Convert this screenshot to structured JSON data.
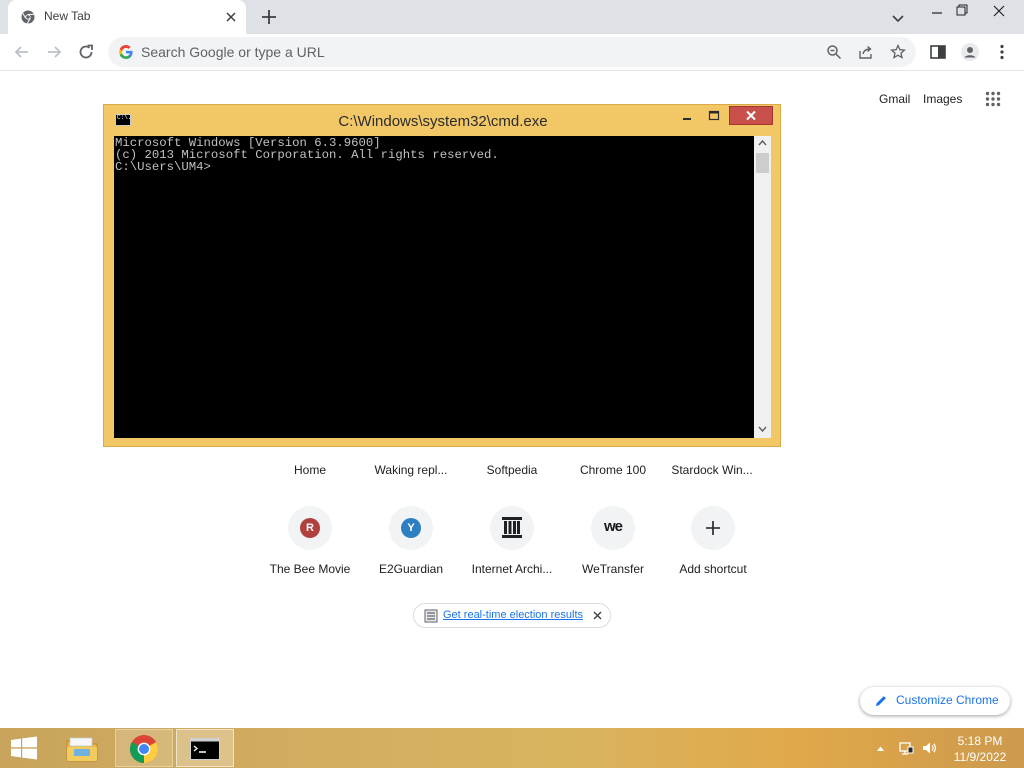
{
  "browser": {
    "tab": {
      "title": "New Tab"
    },
    "omnibox": {
      "placeholder": "Search Google or type a URL"
    },
    "ntp": {
      "gmail": "Gmail",
      "images": "Images",
      "top_row": [
        "Home",
        "Waking repl...",
        "Softpedia",
        "Chrome 100",
        "Stardock Win..."
      ],
      "shortcuts": [
        {
          "label": "The Bee Movie",
          "initial": "R",
          "color": "#b0413e"
        },
        {
          "label": "E2Guardian",
          "initial": "Y",
          "color": "#2d7fc1"
        },
        {
          "label": "Internet Archi...",
          "icon": "archive-icon"
        },
        {
          "label": "WeTransfer",
          "icon": "wetransfer-icon",
          "text": "we"
        },
        {
          "label": "Add shortcut",
          "icon": "plus-icon"
        }
      ],
      "promo": {
        "text": "Get real-time election results"
      },
      "customize": "Customize Chrome"
    }
  },
  "cmd": {
    "title": "C:\\Windows\\system32\\cmd.exe",
    "icon_text": "C:\\.",
    "lines": [
      "Microsoft Windows [Version 6.3.9600]",
      "(c) 2013 Microsoft Corporation. All rights reserved.",
      "C:\\Users\\UM4>"
    ]
  },
  "taskbar": {
    "time": "5:18 PM",
    "date": "11/9/2022",
    "accent": "#d8b45f"
  }
}
